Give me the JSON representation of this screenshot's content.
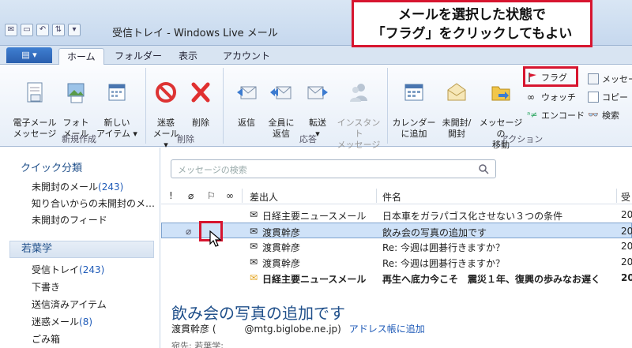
{
  "window": {
    "title": "受信トレイ - Windows Live メール"
  },
  "tabs": [
    "ホーム",
    "フォルダー",
    "表示",
    "アカウント"
  ],
  "ribbon": {
    "groups": {
      "new": "新規作成",
      "delete": "削除",
      "respond": "応答",
      "actions": "アクション"
    },
    "buttons": {
      "email": "電子メール\nメッセージ",
      "photo": "フォト\nメール",
      "new_item": "新しい\nアイテム ▾",
      "junk": "迷惑\nメール ▾",
      "delete": "削除",
      "reply": "返信",
      "reply_all": "全員に\n返信",
      "forward": "転送\n▾",
      "instant": "インスタント\nメッセージ",
      "add_calendar": "カレンダー\nに追加",
      "unread": "未開封/\n開封",
      "move": "メッセージの\n移動"
    },
    "small": {
      "flag": "フラグ",
      "watch": "ウォッチ",
      "encode": "エンコード",
      "message_cut": "メッセー",
      "copy_cut": "コピー",
      "search": "検索"
    }
  },
  "sidebar": {
    "quick_views": "クイック分類",
    "quick_items": [
      {
        "label": "未開封のメール",
        "count": "(243)"
      },
      {
        "label": "知り合いからの未開封のメ…",
        "count": ""
      },
      {
        "label": "未開封のフィード",
        "count": ""
      }
    ],
    "account": "若葉学",
    "folders": [
      {
        "label": "受信トレイ",
        "count": "(243)"
      },
      {
        "label": "下書き",
        "count": ""
      },
      {
        "label": "送信済みアイテム",
        "count": ""
      },
      {
        "label": "迷惑メール",
        "count": "(8)"
      },
      {
        "label": "ごみ箱",
        "count": ""
      }
    ]
  },
  "search": {
    "placeholder": "メッセージの検索"
  },
  "list": {
    "headers": {
      "excl": "!",
      "attach": "⌀",
      "flag": "⚐",
      "watch": "∞",
      "from": "差出人",
      "subject": "件名",
      "date": "受"
    },
    "rows": [
      {
        "from": "日経主要ニュースメール",
        "subject": "日本車をガラパゴス化させない３つの条件",
        "date": "20"
      },
      {
        "from": "渡貫幹彦",
        "subject": "飲み会の写真の追加です",
        "date": "20"
      },
      {
        "from": "渡貫幹彦",
        "subject": "Re: 今週は囲碁行きますか？",
        "date": "20"
      },
      {
        "from": "渡貫幹彦",
        "subject": "Re: 今週は囲碁行きますか？",
        "date": "20"
      },
      {
        "from": "日経主要ニュースメール",
        "subject": "再生へ底力今こそ　震災１年、復興の歩みなお遅く",
        "date": "20"
      }
    ]
  },
  "preview": {
    "title": "飲み会の写真の追加です",
    "from_name": "渡貫幹彦",
    "from_addr": "(　　　@mtg.biglobe.ne.jp)",
    "add_contact": "アドレス帳に追加",
    "to": "宛先: 若葉学;"
  },
  "annotation": {
    "line1": "メールを選択した状態で",
    "line2": "「フラグ」をクリックしてもよい"
  },
  "colors": {
    "accent": "#1f4f8a",
    "highlight": "#d7152f",
    "selected_row": "#cfe2f8"
  }
}
